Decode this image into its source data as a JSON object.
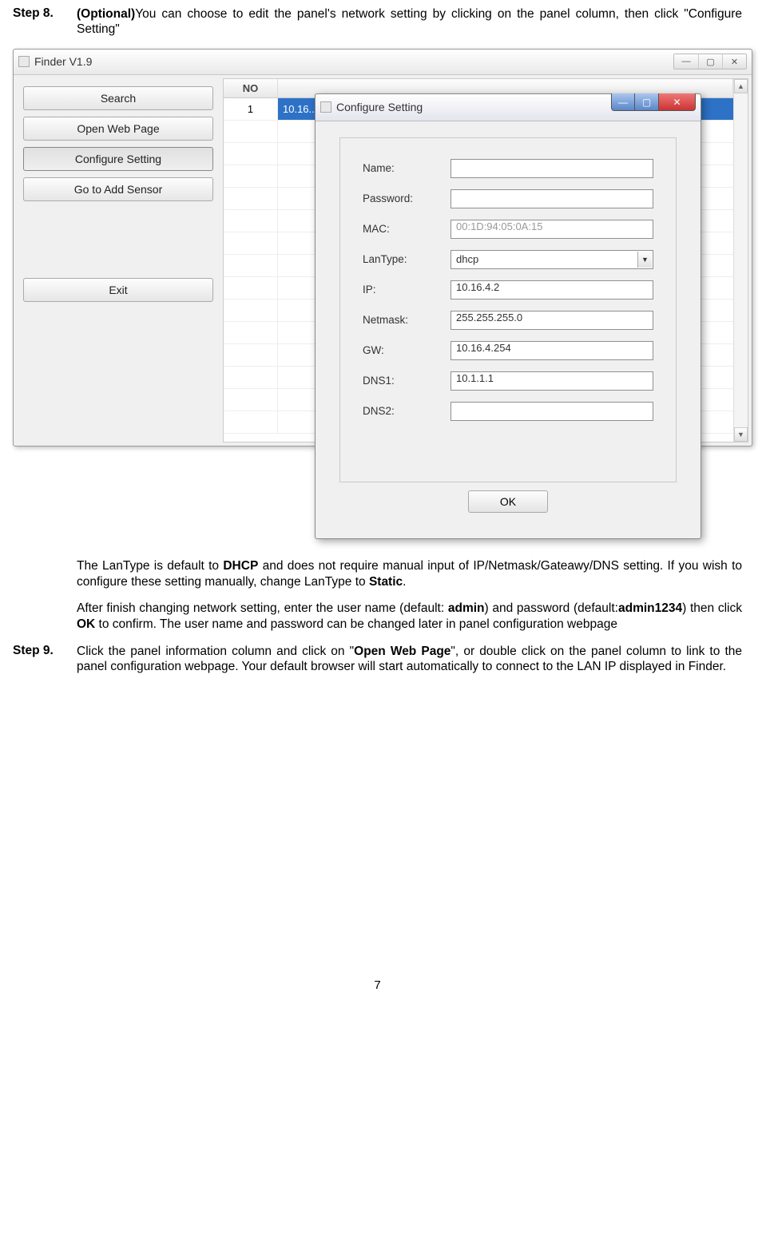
{
  "step8": {
    "label": "Step 8.",
    "optional": "(Optional)",
    "text_a": "You can choose to edit the panel's network setting by clicking on the panel column, then click \"Configure Setting\""
  },
  "finder": {
    "title": "Finder V1.9",
    "buttons": {
      "search": "Search",
      "open_web": "Open Web Page",
      "configure": "Configure Setting",
      "add_sensor": "Go to Add Sensor",
      "exit": "Exit"
    },
    "window_controls": {
      "min": "—",
      "max": "▢",
      "close": "✕"
    },
    "table": {
      "headers": {
        "no": "NO",
        "ip": ""
      },
      "row1_no": "1",
      "row1_ip": "10.16..."
    }
  },
  "config": {
    "title": "Configure Setting",
    "window_controls": {
      "min": "—",
      "max": "▢",
      "close": "✕"
    },
    "fields": {
      "name_label": "Name:",
      "name_value": "",
      "password_label": "Password:",
      "password_value": "",
      "mac_label": "MAC:",
      "mac_value": "00:1D:94:05:0A:15",
      "lantype_label": "LanType:",
      "lantype_value": "dhcp",
      "ip_label": "IP:",
      "ip_value": "10.16.4.2",
      "netmask_label": "Netmask:",
      "netmask_value": "255.255.255.0",
      "gw_label": "GW:",
      "gw_value": "10.16.4.254",
      "dns1_label": "DNS1:",
      "dns1_value": "10.1.1.1",
      "dns2_label": "DNS2:",
      "dns2_value": ""
    },
    "ok": "OK"
  },
  "para1_a": "The LanType is default to ",
  "para1_b": "DHCP",
  "para1_c": " and does not require manual input of IP/Netmask/Gateawy/DNS setting. If you wish to configure these setting manually, change LanType to ",
  "para1_d": "Static",
  "para1_e": ".",
  "para2_a": "After finish changing network setting, enter the user name (default: ",
  "para2_b": "admin",
  "para2_c": ") and password (default:",
  "para2_d": "admin1234",
  "para2_e": ") then click ",
  "para2_f": "OK",
  "para2_g": " to confirm. The user name and password can be changed later in panel configuration webpage",
  "step9": {
    "label": "Step 9.",
    "text_a": "Click the panel information column and click on \"",
    "text_b": "Open Web Page",
    "text_c": "\", or double click on the panel column to link to the panel configuration webpage. Your default browser will start automatically to connect to the LAN IP displayed in Finder."
  },
  "page_number": "7"
}
